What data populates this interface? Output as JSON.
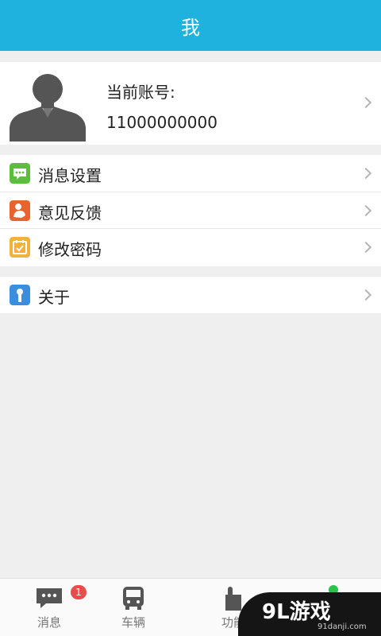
{
  "header": {
    "title": "我"
  },
  "profile": {
    "account_label": "当前账号:",
    "account_value": "11000000000"
  },
  "menu_group1": [
    {
      "label": "消息设置",
      "icon": "message-settings-icon",
      "color": "#5cbf3c"
    },
    {
      "label": "意见反馈",
      "icon": "feedback-icon",
      "color": "#e8632e"
    },
    {
      "label": "修改密码",
      "icon": "password-icon",
      "color": "#efb23a"
    }
  ],
  "menu_group2": [
    {
      "label": "关于",
      "icon": "about-icon",
      "color": "#3b8de0"
    }
  ],
  "tabs": [
    {
      "label": "消息",
      "icon": "message-icon",
      "badge": "1"
    },
    {
      "label": "车辆",
      "icon": "bus-icon"
    },
    {
      "label": "功能",
      "icon": "function-icon"
    },
    {
      "label": "",
      "icon": "me-icon"
    }
  ],
  "watermark": {
    "main": "9L游戏",
    "sub": "91danji.com"
  },
  "colors": {
    "accent": "#1fb2de",
    "badge": "#e84c4c"
  }
}
